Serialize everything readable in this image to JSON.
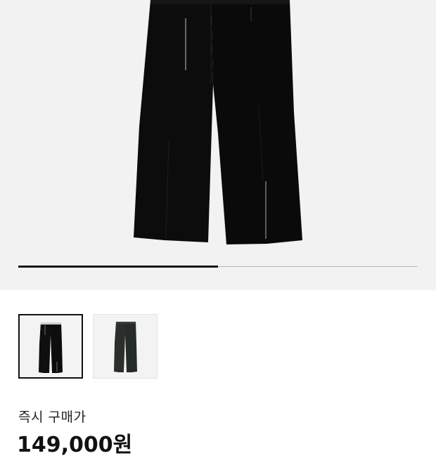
{
  "product": {
    "images": [
      {
        "icon": "pants-black-image",
        "color": "#0f0f0f"
      },
      {
        "icon": "pants-dark-green-image",
        "color": "#2b2f2b"
      }
    ],
    "selected_index": 0
  },
  "gallery": {
    "progress": 0.5
  },
  "price": {
    "label": "즉시 구매가",
    "value": "149,000원"
  }
}
